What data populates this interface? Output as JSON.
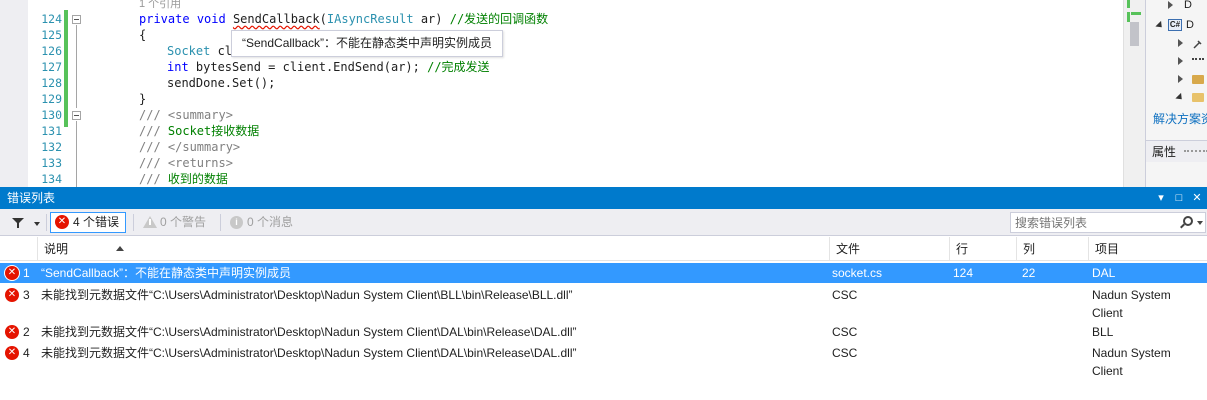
{
  "editor": {
    "line_numbers": [
      "124",
      "125",
      "126",
      "127",
      "128",
      "129",
      "130",
      "131",
      "132",
      "133",
      "134"
    ],
    "ref_count": "1 个引用",
    "line124": {
      "kw1": "private",
      "kw2": "void",
      "method": "SendCallback",
      "paren_open": "(",
      "param_type": "IAsyncResult",
      "param_rest": " ar)",
      "comment": "//发送的回调函数"
    },
    "line125": "{",
    "line126": {
      "type": "Socket",
      "rest": " cl"
    },
    "line127": {
      "kw": "int",
      "rest": " bytesSend = client.EndSend(ar);",
      "comment": "//完成发送"
    },
    "line128": "sendDone.Set();",
    "line129": "}",
    "line130": {
      "prefix": "///",
      "tag": " <summary>"
    },
    "line131": {
      "prefix": "///",
      "text": " Socket接收数据"
    },
    "line132": {
      "prefix": "///",
      "tag": " </summary>"
    },
    "line133": {
      "prefix": "///",
      "tag": " <returns>"
    },
    "line134": {
      "prefix": "///",
      "text": " 收到的数据"
    },
    "tooltip": "“SendCallback”：不能在静态类中声明实例成员"
  },
  "solution_explorer": {
    "items": [
      {
        "label": "D"
      },
      {
        "label": "D"
      },
      {
        "label": ""
      },
      {
        "label": ""
      },
      {
        "label": ""
      },
      {
        "label": ""
      }
    ],
    "cs_badge": "C#",
    "tab_label": "解决方案资",
    "properties_label": "属性"
  },
  "error_list": {
    "title": "错误列表",
    "title_buttons": {
      "dropdown": "▾",
      "maximize": "□",
      "close": "✕"
    },
    "toolbar": {
      "errors_label": "4 个错误",
      "warnings_label": "0 个警告",
      "messages_label": "0 个消息",
      "search_placeholder": "搜索错误列表"
    },
    "columns": {
      "description": "说明",
      "file": "文件",
      "line": "行",
      "column": "列",
      "project": "项目"
    },
    "rows": [
      {
        "index": "1",
        "description": "“SendCallback”：不能在静态类中声明实例成员",
        "file": "socket.cs",
        "line": "124",
        "column": "22",
        "project": "DAL"
      },
      {
        "index": "3",
        "description": "未能找到元数据文件“C:\\Users\\Administrator\\Desktop\\Nadun System Client\\BLL\\bin\\Release\\BLL.dll”",
        "file": "CSC",
        "line": "",
        "column": "",
        "project": "Nadun System Client"
      },
      {
        "index": "2",
        "description": "未能找到元数据文件“C:\\Users\\Administrator\\Desktop\\Nadun System Client\\DAL\\bin\\Release\\DAL.dll”",
        "file": "CSC",
        "line": "",
        "column": "",
        "project": "BLL"
      },
      {
        "index": "4",
        "description": "未能找到元数据文件“C:\\Users\\Administrator\\Desktop\\Nadun System Client\\DAL\\bin\\Release\\DAL.dll”",
        "file": "CSC",
        "line": "",
        "column": "",
        "project": "Nadun System Client"
      }
    ]
  },
  "colors": {
    "accent": "#007acc",
    "selection": "#3399ff",
    "error": "#e51400",
    "change_bar": "#57c25a",
    "keyword": "#0000ff",
    "type": "#2b91af",
    "comment": "#008000"
  }
}
